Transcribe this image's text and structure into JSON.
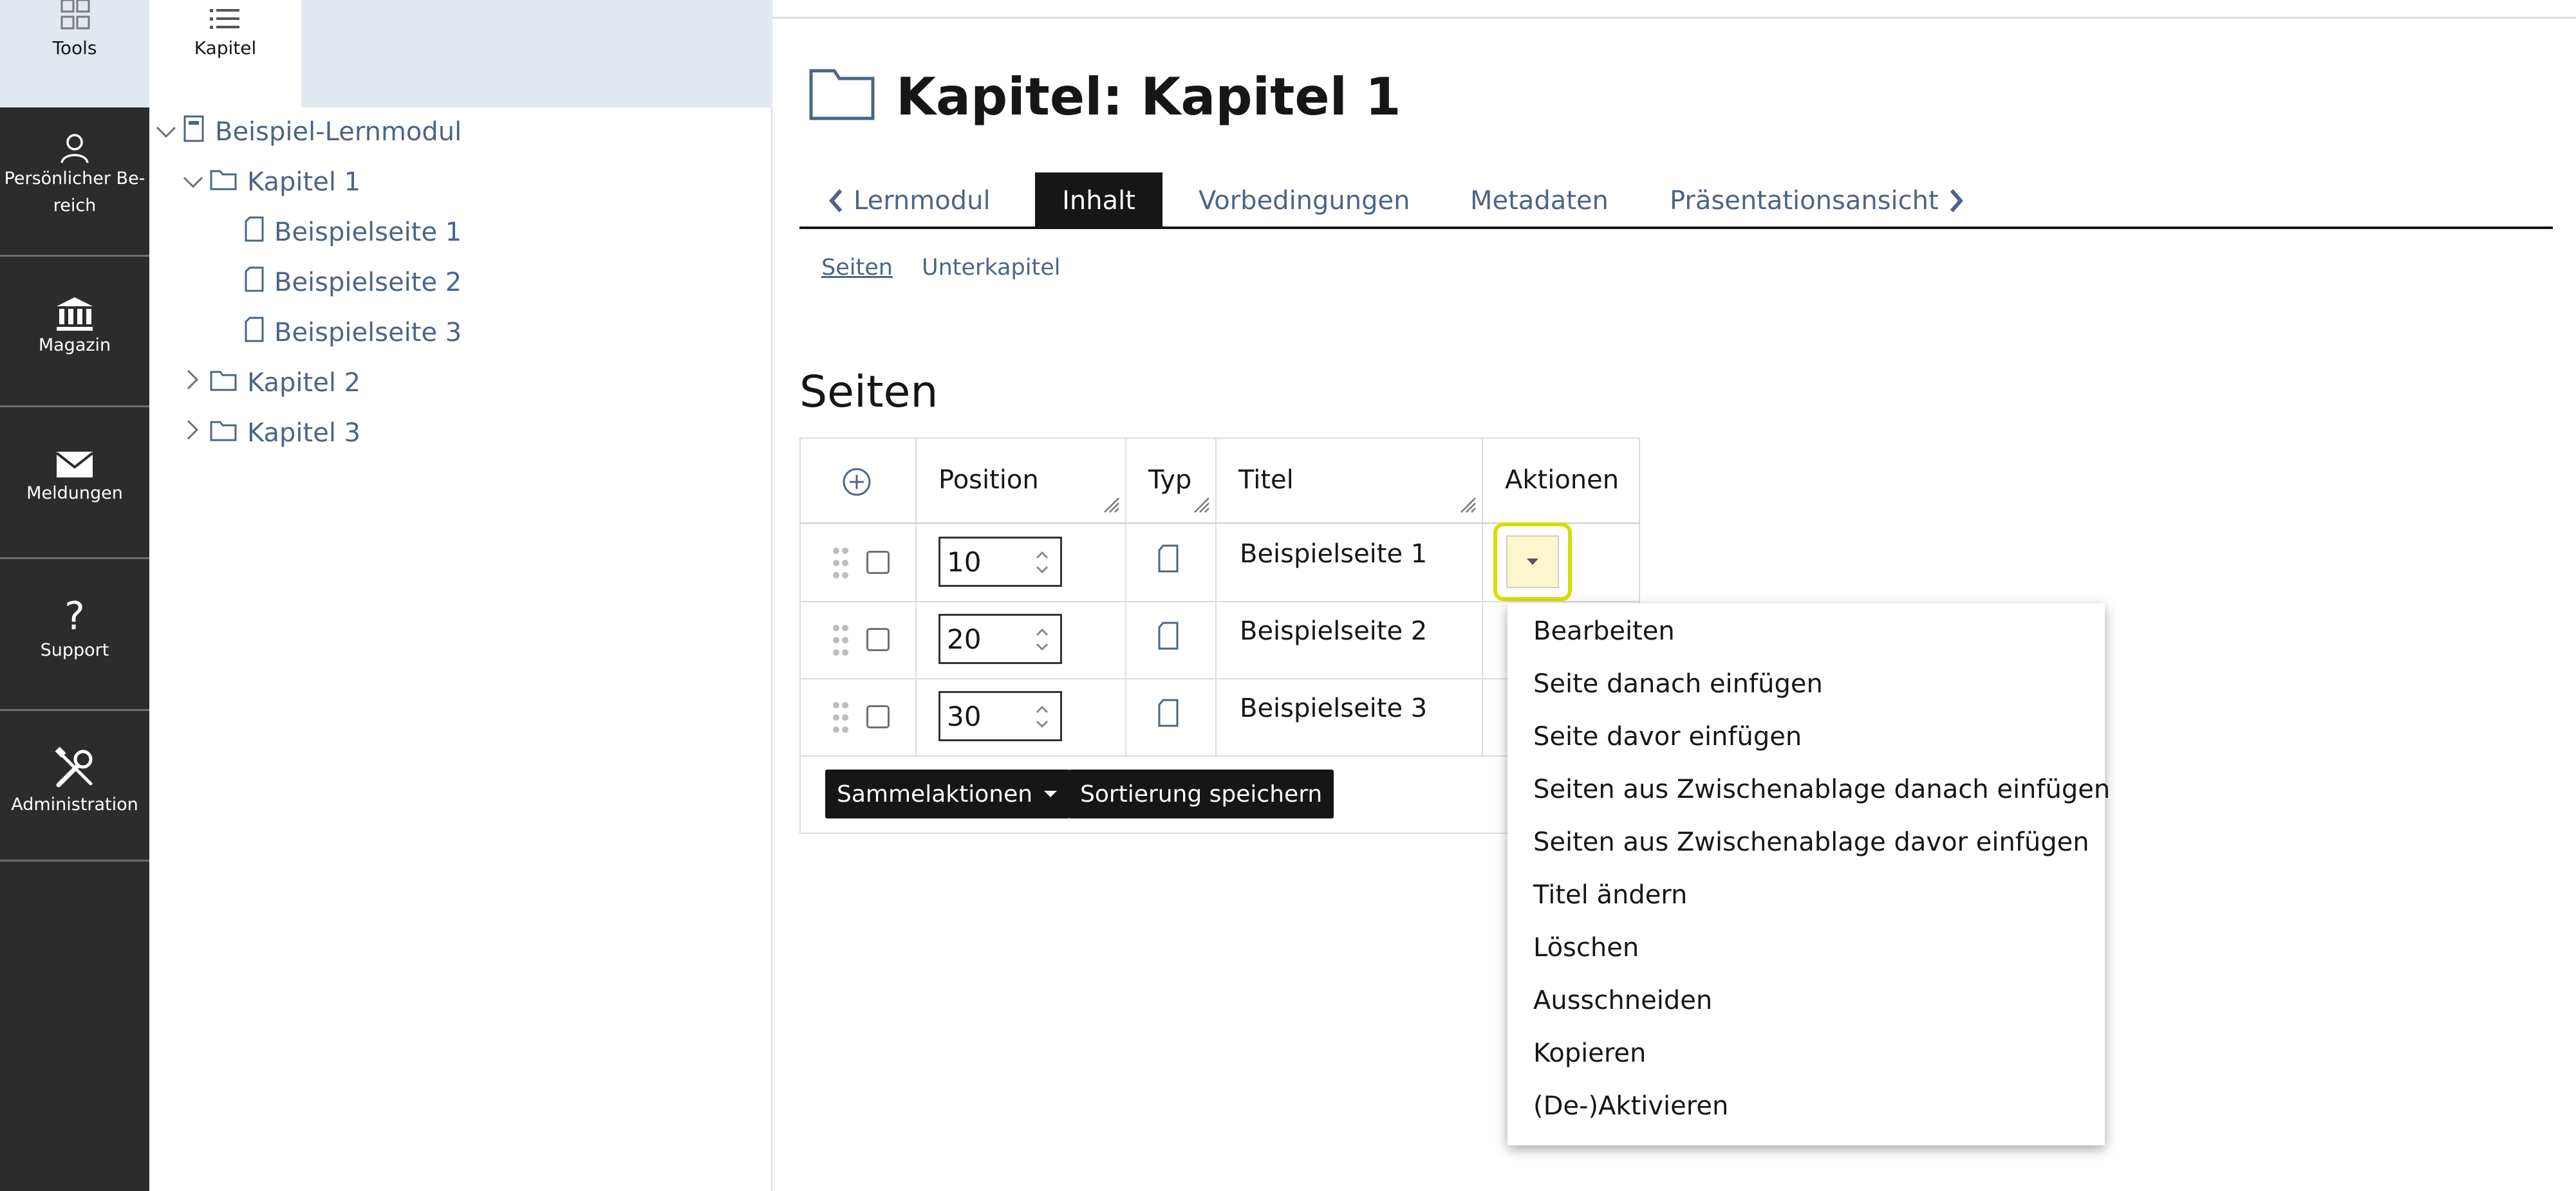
{
  "mainbar": {
    "tools_label": "Tools",
    "items": [
      {
        "label": "Persönlicher Be-",
        "label2": "reich",
        "icon": "user-icon"
      },
      {
        "label": "Magazin",
        "icon": "bank-icon"
      },
      {
        "label": "Meldungen",
        "icon": "envelope-icon"
      },
      {
        "label": "Support",
        "icon": "question-icon"
      },
      {
        "label": "Administration",
        "icon": "tools-icon"
      }
    ]
  },
  "slate": {
    "tab_label": "Kapitel",
    "tree": [
      {
        "label": "Beispiel-Lernmodul",
        "icon": "module-icon",
        "state": "expanded"
      },
      {
        "label": "Kapitel 1",
        "icon": "folder-icon",
        "state": "expanded"
      },
      {
        "label": "Beispielseite 1",
        "icon": "page-icon"
      },
      {
        "label": "Beispielseite 2",
        "icon": "page-icon"
      },
      {
        "label": "Beispielseite 3",
        "icon": "page-icon"
      },
      {
        "label": "Kapitel 2",
        "icon": "folder-icon",
        "state": "collapsed"
      },
      {
        "label": "Kapitel 3",
        "icon": "folder-icon",
        "state": "collapsed"
      }
    ]
  },
  "header": {
    "title": "Kapitel: Kapitel 1"
  },
  "tabs": [
    {
      "label": "Lernmodul",
      "kind": "back"
    },
    {
      "label": "Inhalt",
      "active": true
    },
    {
      "label": "Vorbedingungen"
    },
    {
      "label": "Metadaten"
    },
    {
      "label": "Präsentationsansicht",
      "kind": "forward"
    }
  ],
  "subtabs": [
    {
      "label": "Seiten",
      "active": true
    },
    {
      "label": "Unterkapitel"
    }
  ],
  "section": {
    "title": "Seiten"
  },
  "table": {
    "columns": [
      "Position",
      "Typ",
      "Titel",
      "Aktionen"
    ],
    "rows": [
      {
        "position": "10",
        "title": "Beispielseite 1"
      },
      {
        "position": "20",
        "title": "Beispielseite 2"
      },
      {
        "position": "30",
        "title": "Beispielseite 3"
      }
    ],
    "bulk_actions_label": "Sammelaktionen",
    "save_sort_label": "Sortierung speichern"
  },
  "dropdown": {
    "items": [
      "Bearbeiten",
      "Seite danach einfügen",
      "Seite davor einfügen",
      "Seiten aus Zwischenablage danach einfügen",
      "Seiten aus Zwischenablage davor einfügen",
      "Titel ändern",
      "Löschen",
      "Ausschneiden",
      "Kopieren",
      "(De-)Aktivieren"
    ]
  },
  "colors": {
    "mainbar_bg": "#2c2c2c",
    "link": "#4c6586",
    "active_tab_bg": "#161616",
    "highlight": "#d8de00"
  }
}
